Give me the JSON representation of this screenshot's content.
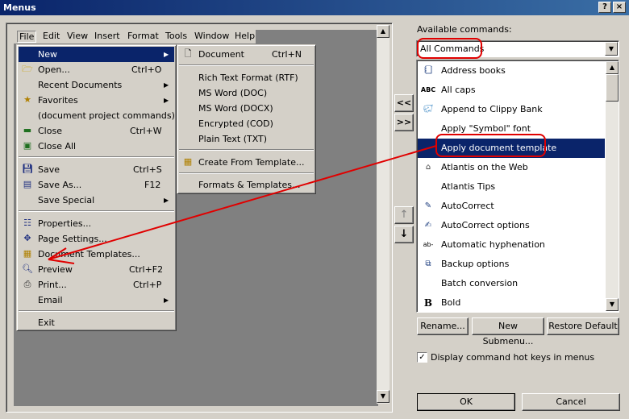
{
  "window": {
    "title": "Menus",
    "help_btn": "?",
    "close_btn": "×"
  },
  "menubar": [
    "File",
    "Edit",
    "View",
    "Insert",
    "Format",
    "Tools",
    "Window",
    "Help"
  ],
  "file_menu": [
    {
      "label": "New",
      "accel": "",
      "submenu": true,
      "selected": true
    },
    {
      "label": "Open...",
      "accel": "Ctrl+O"
    },
    {
      "label": "Recent Documents",
      "accel": "",
      "submenu": true
    },
    {
      "label": "Favorites",
      "accel": "",
      "submenu": true
    },
    {
      "label": "(document project commands)",
      "accel": ""
    },
    {
      "label": "Close",
      "accel": "Ctrl+W"
    },
    {
      "label": "Close All",
      "accel": ""
    },
    {
      "label": "Save",
      "accel": "Ctrl+S"
    },
    {
      "label": "Save As...",
      "accel": "F12"
    },
    {
      "label": "Save Special",
      "accel": "",
      "submenu": true
    },
    {
      "label": "Properties...",
      "accel": ""
    },
    {
      "label": "Page Settings...",
      "accel": ""
    },
    {
      "label": "Document Templates...",
      "accel": ""
    },
    {
      "label": "Preview",
      "accel": "Ctrl+F2"
    },
    {
      "label": "Print...",
      "accel": "Ctrl+P"
    },
    {
      "label": "Email",
      "accel": "",
      "submenu": true
    },
    {
      "label": "Exit",
      "accel": ""
    }
  ],
  "new_submenu": [
    {
      "label": "Document",
      "accel": "Ctrl+N"
    },
    {
      "label": "Rich Text Format (RTF)",
      "accel": ""
    },
    {
      "label": "MS Word (DOC)",
      "accel": ""
    },
    {
      "label": "MS Word (DOCX)",
      "accel": ""
    },
    {
      "label": "Encrypted (COD)",
      "accel": ""
    },
    {
      "label": "Plain Text (TXT)",
      "accel": ""
    },
    {
      "label": "Create From Template...",
      "accel": ""
    },
    {
      "label": "Formats & Templates...",
      "accel": ""
    }
  ],
  "right": {
    "available_label": "Available commands:",
    "combo_value": "All Commands",
    "commands": [
      {
        "label": "Address books",
        "icon": "address-book-icon"
      },
      {
        "label": "All caps",
        "icon": "abc-icon"
      },
      {
        "label": "Append to Clippy Bank",
        "icon": "piggy-bank-icon"
      },
      {
        "label": "Apply \"Symbol\" font",
        "icon": ""
      },
      {
        "label": "Apply document template",
        "icon": "",
        "selected": true
      },
      {
        "label": "Atlantis on the Web",
        "icon": "home-icon"
      },
      {
        "label": "Atlantis Tips",
        "icon": ""
      },
      {
        "label": "AutoCorrect",
        "icon": "autocorrect-icon"
      },
      {
        "label": "AutoCorrect options",
        "icon": "autocorrect-options-icon"
      },
      {
        "label": "Automatic hyphenation",
        "icon": "hyphenation-icon"
      },
      {
        "label": "Backup options",
        "icon": "backup-icon"
      },
      {
        "label": "Batch conversion",
        "icon": ""
      },
      {
        "label": "Bold",
        "icon": "bold-icon"
      }
    ],
    "rename_btn": "Rename...",
    "new_submenu_btn": "New Submenu...",
    "restore_btn": "Restore Default",
    "hotkeys_label": "Display command hot keys in menus",
    "hotkeys_checked": true,
    "ok_btn": "OK",
    "cancel_btn": "Cancel",
    "add_btn": "<<",
    "remove_btn": ">>",
    "up_btn": "↑",
    "down_btn": "↓"
  },
  "annotation_color": "#e00000"
}
